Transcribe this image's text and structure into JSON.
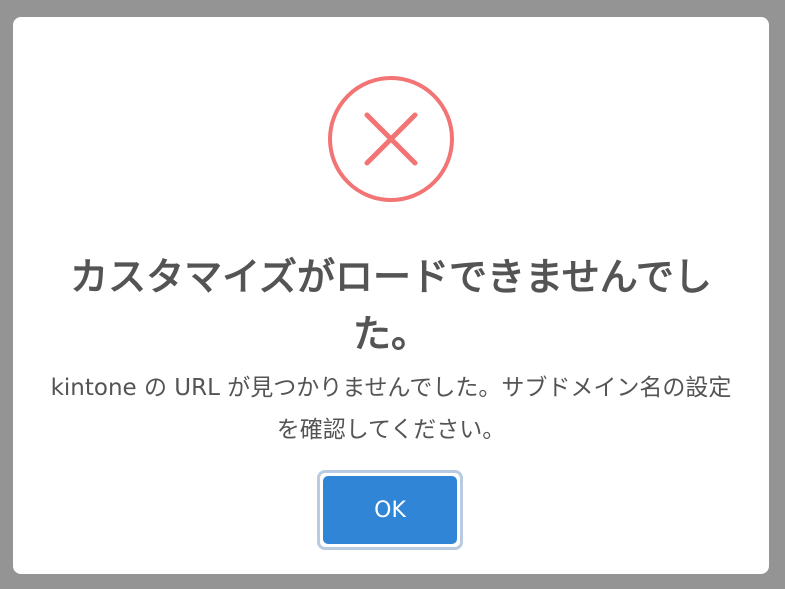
{
  "dialog": {
    "icon": "error-x-icon",
    "icon_color": "#f27474",
    "title": "カスタマイズがロードできませんでした。",
    "message": "kintone の URL が見つかりませんでした。サブドメイン名の設定を確認してください。",
    "ok_label": "OK",
    "button_color": "#3085d6"
  }
}
